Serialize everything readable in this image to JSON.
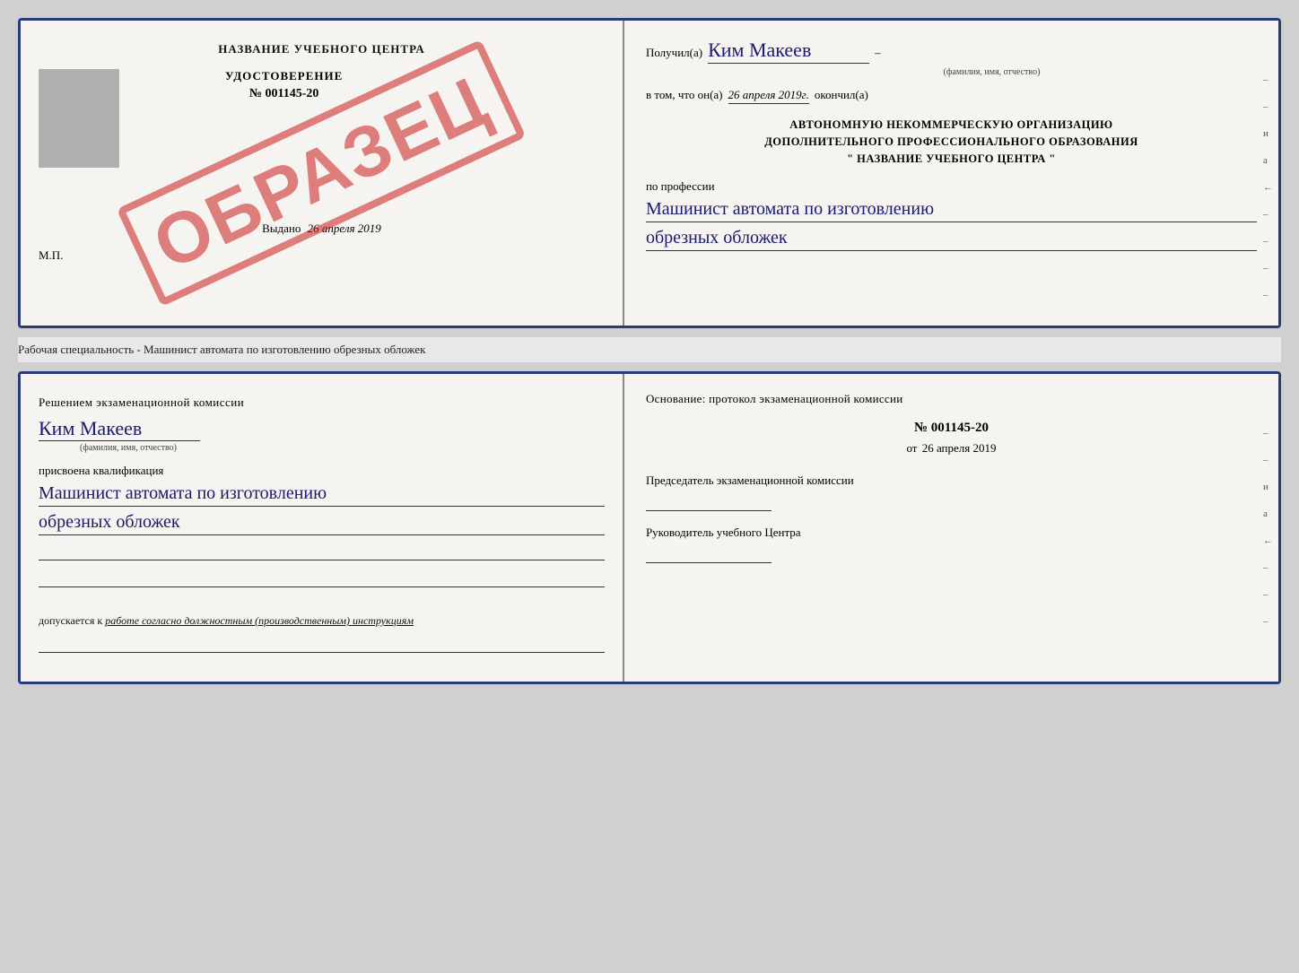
{
  "top_doc": {
    "left": {
      "title": "НАЗВАНИЕ УЧЕБНОГО ЦЕНТРА",
      "stamp": "ОБРАЗЕЦ",
      "cert_label": "УДОСТОВЕРЕНИЕ",
      "cert_number": "№ 001145-20",
      "vydano_label": "Выдано",
      "vydano_date": "26 апреля 2019",
      "mp_label": "М.П."
    },
    "right": {
      "poluchil_label": "Получил(а)",
      "poluchil_name": "Ким Макеев",
      "fio_hint": "(фамилия, имя, отчество)",
      "vtom_label": "в том, что он(а)",
      "vtom_date": "26 апреля 2019г.",
      "okonchil_label": "окончил(а)",
      "org_line1": "АВТОНОМНУЮ НЕКОММЕРЧЕСКУЮ ОРГАНИЗАЦИЮ",
      "org_line2": "ДОПОЛНИТЕЛЬНОГО ПРОФЕССИОНАЛЬНОГО ОБРАЗОВАНИЯ",
      "org_quote_open": "\"",
      "org_name": "НАЗВАНИЕ УЧЕБНОГО ЦЕНТРА",
      "org_quote_close": "\"",
      "po_professii": "по профессии",
      "profession_line1": "Машинист автомата по изготовлению",
      "profession_line2": "обрезных обложек",
      "side_marks": [
        "-",
        "-",
        "и",
        "а",
        "←",
        "-",
        "-",
        "-",
        "-"
      ]
    }
  },
  "separator": {
    "text": "Рабочая специальность - Машинист автомата по изготовлению обрезных обложек"
  },
  "bottom_doc": {
    "left": {
      "resheniem_label": "Решением экзаменационной комиссии",
      "name": "Ким Макеев",
      "fio_hint": "(фамилия, имя, отчество)",
      "prisvоena_label": "присвоена квалификация",
      "profession_line1": "Машинист автомата по изготовлению",
      "profession_line2": "обрезных обложек",
      "dopuskaetsya": "допускается к",
      "dopuskaetsya_text": "работе согласно должностным (производственным) инструкциям"
    },
    "right": {
      "osnovanie_label": "Основание: протокол экзаменационной комиссии",
      "protocol_number": "№ 001145-20",
      "ot_prefix": "от",
      "ot_date": "26 апреля 2019",
      "predsedatel_label": "Председатель экзаменационной комиссии",
      "rukovoditel_label": "Руководитель учебного Центра",
      "side_marks": [
        "-",
        "-",
        "и",
        "а",
        "←",
        "-",
        "-",
        "-"
      ]
    }
  }
}
